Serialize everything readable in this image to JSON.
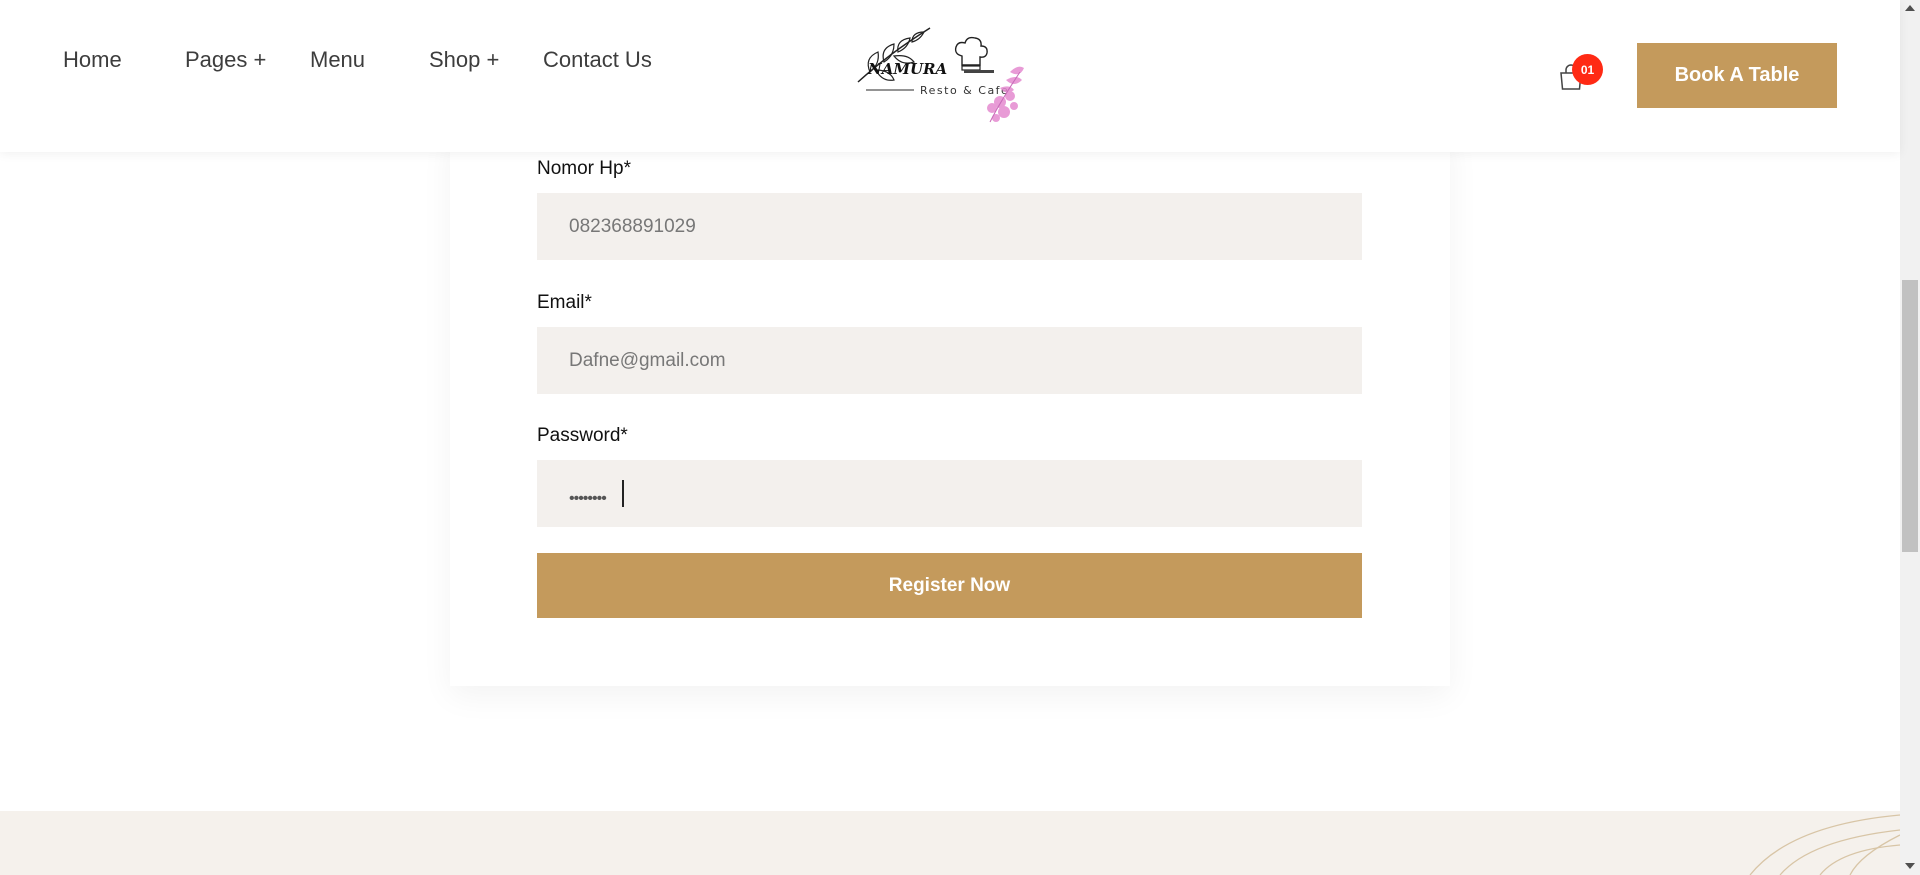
{
  "nav": {
    "items": [
      {
        "label": "Home"
      },
      {
        "label": "Pages +"
      },
      {
        "label": "Menu"
      },
      {
        "label": "Shop +"
      },
      {
        "label": "Contact Us"
      }
    ]
  },
  "logo": {
    "name": "NAMURA",
    "tagline": "Resto & Cafe"
  },
  "cart": {
    "icon": "shopping-bag-icon",
    "count": "01"
  },
  "header": {
    "book_label": "Book A Table"
  },
  "form": {
    "phone_label": "Nomor Hp*",
    "phone_value": "082368891029",
    "email_label": "Email*",
    "email_value": "Dafne@gmail.com",
    "password_label": "Password*",
    "password_value": "••••••••",
    "submit_label": "Register Now"
  },
  "colors": {
    "accent": "#c49a5c",
    "badge": "#ff2a14",
    "field_bg": "#f3f0ed",
    "footer_bg": "#f5f1ec"
  }
}
